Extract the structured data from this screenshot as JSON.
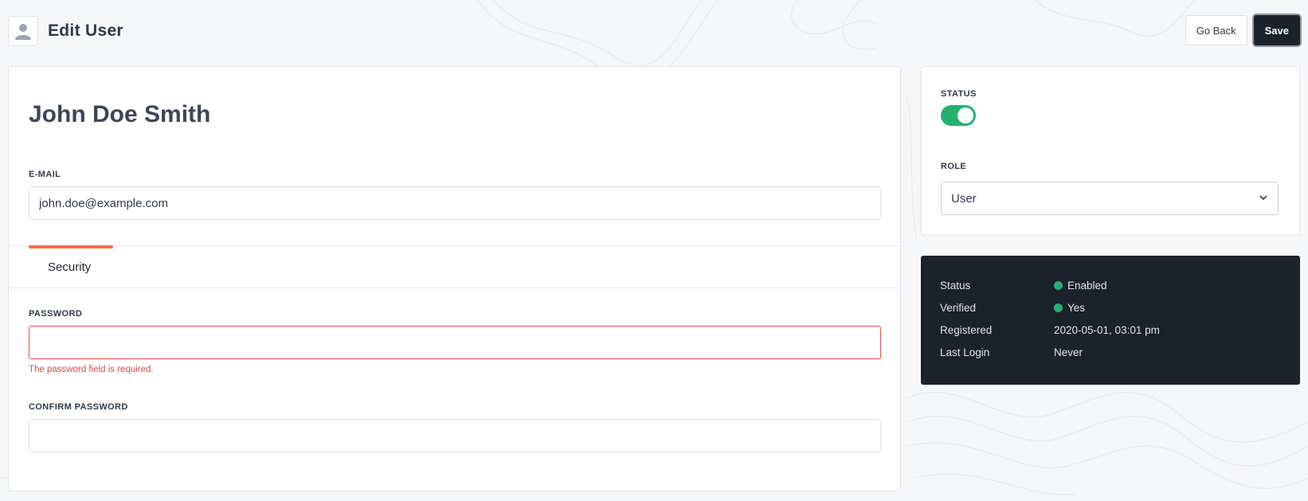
{
  "header": {
    "title": "Edit User",
    "go_back_label": "Go Back",
    "save_label": "Save"
  },
  "user": {
    "full_name": "John Doe Smith"
  },
  "form": {
    "email_label": "E-MAIL",
    "email_value": "john.doe@example.com",
    "password_label": "PASSWORD",
    "password_error": "The password field is required.",
    "confirm_password_label": "CONFIRM PASSWORD"
  },
  "tabs": [
    {
      "label": "Security",
      "active": true
    }
  ],
  "settings": {
    "status_label": "STATUS",
    "status_enabled": true,
    "role_label": "ROLE",
    "role_value": "User"
  },
  "info": {
    "rows": [
      {
        "key": "Status",
        "value": "Enabled",
        "indicator": "green"
      },
      {
        "key": "Verified",
        "value": "Yes",
        "indicator": "green"
      },
      {
        "key": "Registered",
        "value": "2020-05-01, 03:01 pm"
      },
      {
        "key": "Last Login",
        "value": "Never"
      }
    ]
  },
  "colors": {
    "accent": "#f26f4e",
    "success": "#23b26d",
    "error": "#e04848",
    "dark": "#1c222c"
  },
  "icons": {
    "avatar": "user-icon",
    "select_arrow": "chevron-down-icon"
  }
}
